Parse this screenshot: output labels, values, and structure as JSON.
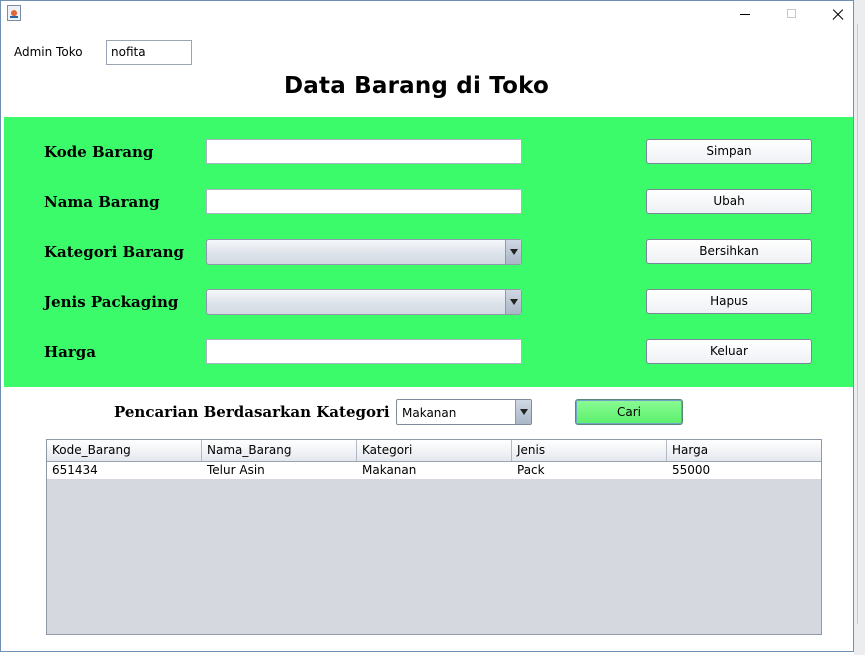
{
  "window": {
    "title_icon": "java-icon",
    "controls": [
      "minimize-icon",
      "maximize-icon",
      "close-icon"
    ]
  },
  "header": {
    "admin_label": "Admin Toko",
    "admin_value": "nofita",
    "title": "Data Barang di Toko"
  },
  "form": {
    "kode_label": "Kode Barang",
    "nama_label": "Nama Barang",
    "kategori_label": "Kategori Barang",
    "jenis_label": "Jenis Packaging",
    "harga_label": "Harga",
    "kode_value": "",
    "nama_value": "",
    "kategori_value": "",
    "jenis_value": "",
    "harga_value": "",
    "panel_color": "#3cfb6a"
  },
  "actions": {
    "simpan": "Simpan",
    "ubah": "Ubah",
    "bersihkan": "Bersihkan",
    "hapus": "Hapus",
    "keluar": "Keluar"
  },
  "search": {
    "label": "Pencarian Berdasarkan Kategori",
    "selected": "Makanan",
    "button": "Cari",
    "button_color": "#6ff57c"
  },
  "table": {
    "columns": [
      "Kode_Barang",
      "Nama_Barang",
      "Kategori",
      "Jenis",
      "Harga"
    ],
    "rows": [
      [
        "651434",
        "Telur Asin",
        "Makanan",
        "Pack",
        "55000"
      ]
    ]
  }
}
